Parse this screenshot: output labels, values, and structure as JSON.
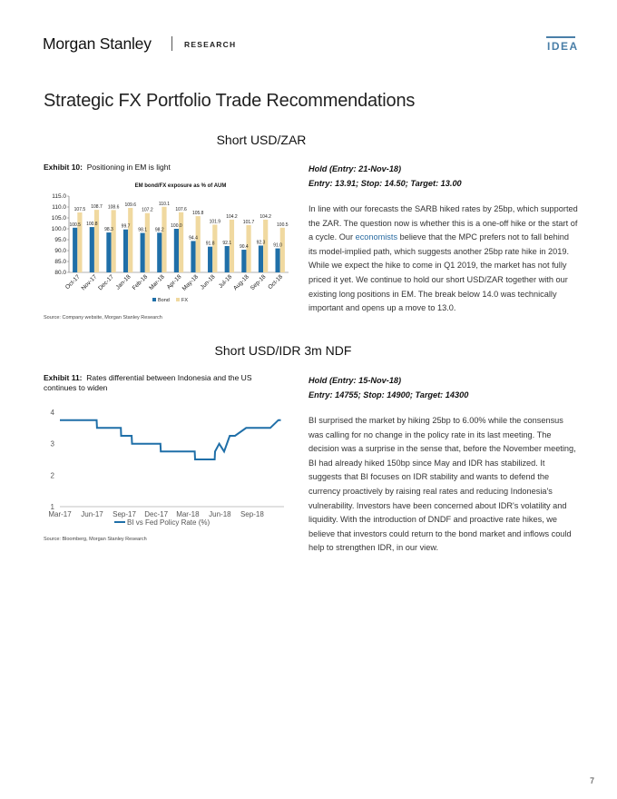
{
  "header": {
    "brand": "Morgan Stanley",
    "section": "RESEARCH",
    "badge": "IDEA"
  },
  "page_title": "Strategic FX Portfolio Trade Recommendations",
  "sections": [
    {
      "title": "Short USD/ZAR",
      "exhibit_num": "Exhibit 10:",
      "exhibit_title": "Positioning in EM is light",
      "source": "Source: Company website, Morgan Stanley Research",
      "status": "Hold (Entry: 21-Nov-18)",
      "levels": "Entry: 13.91; Stop: 14.50; Target: 13.00",
      "body_a": "In line with our forecasts the SARB hiked rates by 25bp, which supported the ZAR. The question now is whether this is a one-off hike or the start of a cycle. Our ",
      "body_link": "economists",
      "body_b": " believe that the MPC prefers not to fall behind its model-implied path, which suggests another 25bp rate hike in 2019. While we expect the hike to come in Q1 2019, the market has not fully priced it yet. We continue to hold our short USD/ZAR together with our existing long positions in EM. The break below 14.0 was technically important and opens up a move to 13.0."
    },
    {
      "title": "Short USD/IDR 3m NDF",
      "exhibit_num": "Exhibit 11:",
      "exhibit_title": "Rates differential between Indonesia and the US continues to widen",
      "source": "Source: Bloomberg, Morgan Stanley Research",
      "status": "Hold (Entry: 15-Nov-18)",
      "levels": "Entry: 14755; Stop: 14900; Target: 14300",
      "body": "BI surprised the market by hiking 25bp to 6.00% while the consensus was calling for no change in the policy rate in its last meeting. The decision was a surprise in the sense that, before the November meeting, BI had already hiked 150bp since May and IDR has stabilized. It suggests that BI focuses on IDR stability and wants to defend the currency proactively by raising real rates and reducing Indonesia's vulnerability. Investors have been concerned about IDR's volatility and liquidity. With the introduction of DNDF and proactive rate hikes, we believe that investors could return to the bond market and inflows could help to strengthen IDR, in our view."
    }
  ],
  "page_number": "7",
  "chart_data": [
    {
      "type": "bar",
      "title": "EM bond/FX exposure as % of AUM",
      "categories": [
        "Oct-17",
        "Nov-17",
        "Dec-17",
        "Jan-18",
        "Feb-18",
        "Mar-18",
        "Apr-18",
        "May-18",
        "Jun-18",
        "Jul-18",
        "Aug-18",
        "Sep-18",
        "Oct-18"
      ],
      "series": [
        {
          "name": "Bond",
          "color": "#1f6fa8",
          "values": [
            100.5,
            100.8,
            98.3,
            99.7,
            98.1,
            98.2,
            100.0,
            94.4,
            91.8,
            92.1,
            90.4,
            92.3,
            91.0
          ]
        },
        {
          "name": "FX",
          "color": "#f0d9a0",
          "values": [
            107.5,
            108.7,
            108.6,
            109.6,
            107.2,
            110.1,
            107.6,
            105.8,
            101.9,
            104.2,
            101.7,
            104.2,
            100.5
          ]
        }
      ],
      "data_labels": {
        "Bond": [
          "100.5",
          "100.8",
          "98.3",
          "99.7",
          "98.1",
          "98.2",
          "100.0",
          "94.4",
          "91.8",
          "92.1",
          "90.4",
          "92.3",
          "91.0"
        ],
        "FX": [
          "107.5",
          "108.7",
          "108.6",
          "109.6",
          "107.2",
          "110.1",
          "107.6",
          "105.8",
          "101.9",
          "104.2",
          "101.7",
          "104.2",
          "100.5"
        ]
      },
      "ylim": [
        80,
        115
      ],
      "yticks": [
        "80.0",
        "85.0",
        "90.0",
        "95.0",
        "100.0",
        "105.0",
        "110.0",
        "115.0"
      ],
      "legend": "bottom",
      "grid": false
    },
    {
      "type": "line",
      "x_ticks": [
        "Mar-17",
        "Jun-17",
        "Sep-17",
        "Dec-17",
        "Mar-18",
        "Jun-18",
        "Sep-18"
      ],
      "ylim": [
        1,
        4
      ],
      "yticks": [
        "1",
        "2",
        "3",
        "4"
      ],
      "series": [
        {
          "name": "BI vs Fed Policy Rate (%)",
          "color": "#1f6fa8",
          "points": [
            [
              "2017-03-01",
              3.75
            ],
            [
              "2017-06-14",
              3.75
            ],
            [
              "2017-06-15",
              3.5
            ],
            [
              "2017-08-22",
              3.5
            ],
            [
              "2017-08-23",
              3.25
            ],
            [
              "2017-09-22",
              3.25
            ],
            [
              "2017-09-23",
              3.0
            ],
            [
              "2017-12-13",
              3.0
            ],
            [
              "2017-12-14",
              2.75
            ],
            [
              "2018-03-21",
              2.75
            ],
            [
              "2018-03-22",
              2.5
            ],
            [
              "2018-05-17",
              2.5
            ],
            [
              "2018-05-18",
              2.75
            ],
            [
              "2018-05-30",
              3.0
            ],
            [
              "2018-06-13",
              2.75
            ],
            [
              "2018-06-29",
              3.25
            ],
            [
              "2018-07-14",
              3.25
            ],
            [
              "2018-08-15",
              3.5
            ],
            [
              "2018-09-26",
              3.5
            ],
            [
              "2018-09-27",
              3.5
            ],
            [
              "2018-10-23",
              3.5
            ],
            [
              "2018-11-15",
              3.75
            ],
            [
              "2018-11-22",
              3.75
            ]
          ]
        }
      ],
      "legend": "bottom",
      "grid": false
    }
  ]
}
